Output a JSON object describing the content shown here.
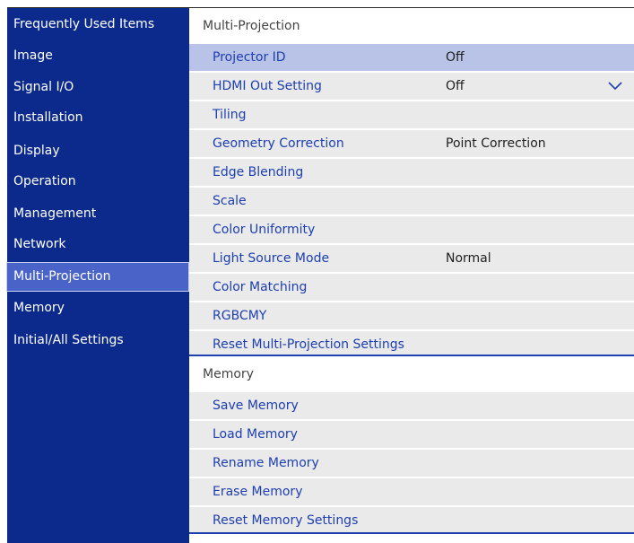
{
  "sidebar": {
    "items": [
      {
        "label": "Frequently Used Items"
      },
      {
        "label": "Image"
      },
      {
        "label": "Signal I/O"
      },
      {
        "label": "Installation"
      },
      {
        "label": "Display"
      },
      {
        "label": "Operation"
      },
      {
        "label": "Management"
      },
      {
        "label": "Network"
      },
      {
        "label": "Multi-Projection",
        "selected": true
      },
      {
        "label": "Memory"
      },
      {
        "label": "Initial/All Settings"
      }
    ]
  },
  "main": {
    "sections": [
      {
        "title": "Multi-Projection",
        "rows": [
          {
            "label": "Projector ID",
            "value": "Off"
          },
          {
            "label": "HDMI Out Setting",
            "value": "Off",
            "icon": "chevron-down-icon"
          },
          {
            "label": "Tiling",
            "value": ""
          },
          {
            "label": "Geometry Correction",
            "value": "Point Correction"
          },
          {
            "label": "Edge Blending",
            "value": ""
          },
          {
            "label": "Scale",
            "value": ""
          },
          {
            "label": "Color Uniformity",
            "value": ""
          },
          {
            "label": "Light Source Mode",
            "value": "Normal"
          },
          {
            "label": "Color Matching",
            "value": ""
          },
          {
            "label": "RGBCMY",
            "value": ""
          },
          {
            "label": "Reset Multi-Projection Settings",
            "value": ""
          }
        ]
      },
      {
        "title": "Memory",
        "rows": [
          {
            "label": "Save Memory"
          },
          {
            "label": "Load Memory"
          },
          {
            "label": "Rename Memory"
          },
          {
            "label": "Erase Memory"
          },
          {
            "label": "Reset Memory Settings"
          }
        ]
      }
    ]
  },
  "colors": {
    "sidebar_bg": "#0b2a8c",
    "sidebar_selected": "#4a63c8",
    "row_bg": "#eaeaea",
    "row_highlight": "#b9c3e7",
    "row_text": "#1d3fb0"
  }
}
